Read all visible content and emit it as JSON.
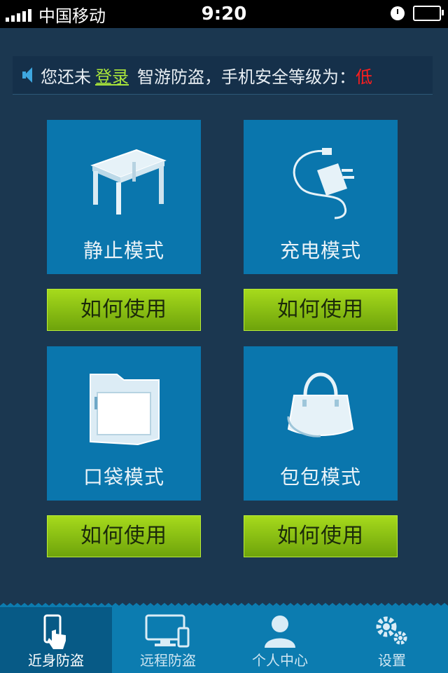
{
  "status_bar": {
    "carrier": "中国移动",
    "time": "9:20"
  },
  "notice": {
    "prefix": "您还未",
    "login_link": "登录",
    "middle": "智游防盗，手机安全等级为：",
    "level": "低"
  },
  "modes": [
    {
      "label": "静止模式",
      "icon": "table-icon",
      "button": "如何使用"
    },
    {
      "label": "充电模式",
      "icon": "charger-icon",
      "button": "如何使用"
    },
    {
      "label": "口袋模式",
      "icon": "pocket-icon",
      "button": "如何使用"
    },
    {
      "label": "包包模式",
      "icon": "handbag-icon",
      "button": "如何使用"
    }
  ],
  "tabs": [
    {
      "label": "近身防盗",
      "icon": "hand-phone-icon",
      "active": true
    },
    {
      "label": "远程防盗",
      "icon": "monitor-phone-icon",
      "active": false
    },
    {
      "label": "个人中心",
      "icon": "person-icon",
      "active": false
    },
    {
      "label": "设置",
      "icon": "gear-icon",
      "active": false
    }
  ],
  "colors": {
    "background": "#1b3750",
    "tile": "#0a76ad",
    "button_green": "#8cc614",
    "login_link": "#a9e53a",
    "level_low": "#ff1e1e",
    "tabbar": "#0c7cb0"
  }
}
